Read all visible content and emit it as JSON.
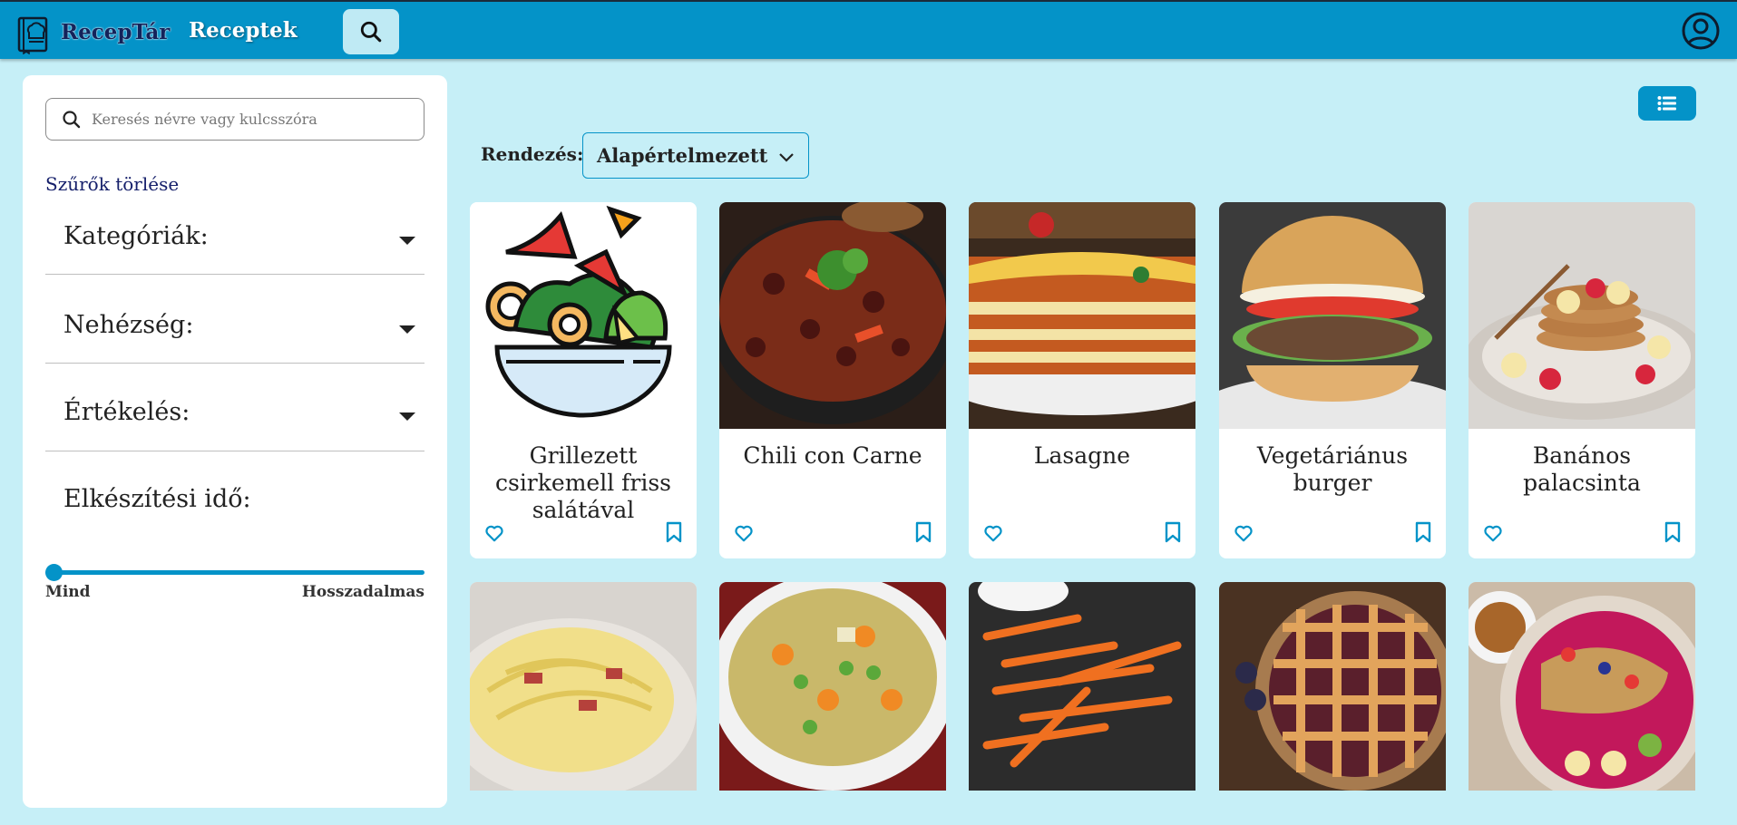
{
  "header": {
    "brand": "RecepTár",
    "nav_recipes": "Receptek",
    "icons": {
      "logo": "chef-book-icon",
      "search": "search-icon",
      "account": "user-circle-icon"
    }
  },
  "sidebar": {
    "search_placeholder": "Keresés névre vagy kulcsszóra",
    "clear_filters": "Szűrők törlése",
    "filters": [
      {
        "label": "Kategóriák:"
      },
      {
        "label": "Nehézség:"
      },
      {
        "label": "Értékelés:"
      }
    ],
    "time": {
      "label": "Elkészítési idő:",
      "min_label": "Mind",
      "max_label": "Hosszadalmas",
      "value_fraction": 0
    }
  },
  "main": {
    "sort_label": "Rendezés:",
    "sort_value": "Alapértelmezett",
    "view_toggle_icon": "list-icon",
    "cards": [
      {
        "title": "Grillezett csirkemell friss salátával",
        "image": "salad-bowl-illustration"
      },
      {
        "title": "Chili con Carne",
        "image": "chili-con-carne-photo"
      },
      {
        "title": "Lasagne",
        "image": "lasagne-photo"
      },
      {
        "title": "Vegetáriánus burger",
        "image": "veggie-burger-photo"
      },
      {
        "title": "Banános palacsinta",
        "image": "banana-pancakes-photo"
      },
      {
        "title": "",
        "image": "carbonara-photo"
      },
      {
        "title": "",
        "image": "vegetable-soup-photo"
      },
      {
        "title": "",
        "image": "sweet-potato-fries-photo"
      },
      {
        "title": "",
        "image": "lattice-pie-photo"
      },
      {
        "title": "",
        "image": "smoothie-bowl-photo"
      }
    ],
    "colors": {
      "accent": "#0493c8",
      "background": "#c6eff7",
      "card": "#ffffff"
    }
  }
}
